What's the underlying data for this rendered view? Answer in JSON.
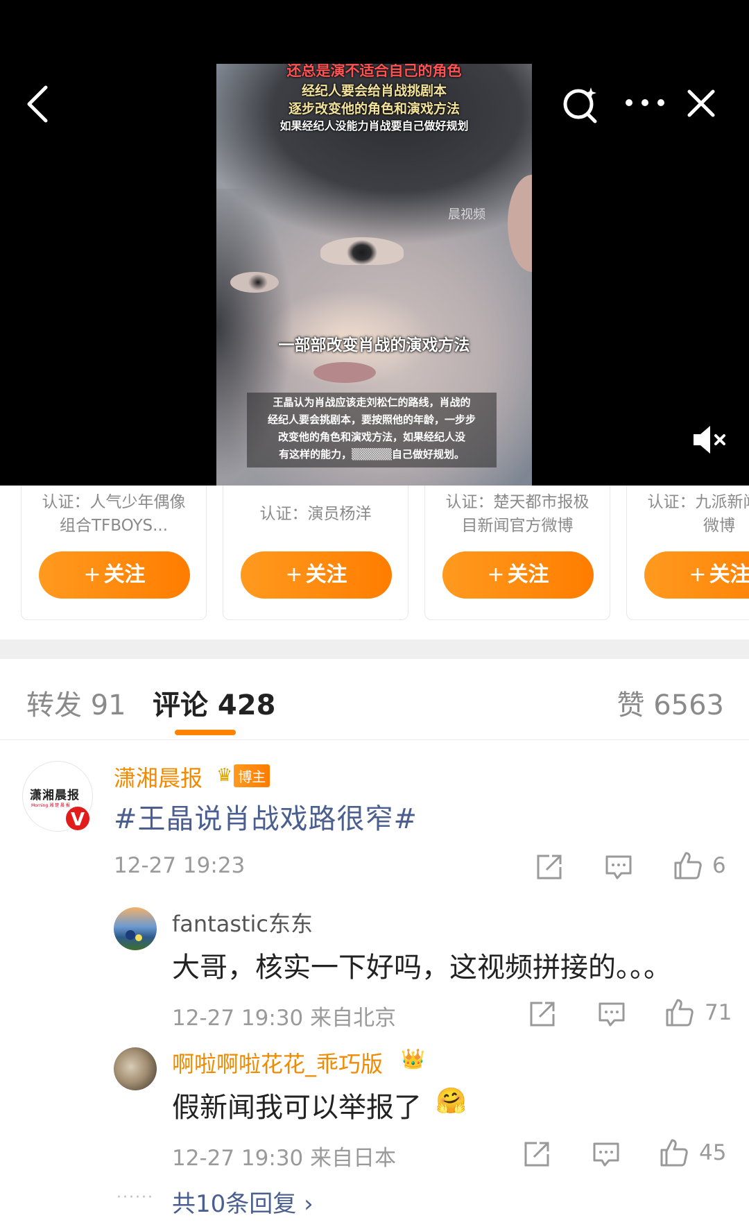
{
  "video": {
    "captions_top": [
      "还总是演不适合自己的角色",
      "经纪人要会给肖战挑剧本",
      "逐步改变他的角色和演戏方法",
      "如果经纪人没能力肖战要自己做好规划"
    ],
    "watermark": "晨视频",
    "caption_middle": "一部部改变肖战的演戏方法",
    "subtitle_lines": [
      "王晶认为肖战应该走刘松仁的路线，肖战的",
      "经纪人要会挑剧本，要按照他的年龄，一步步",
      "改变他的角色和演戏方法，如果经纪人没",
      "有这样的能力，▒▒▒▒▒自己做好规划。"
    ]
  },
  "recommendations": [
    {
      "cert": "认证：人气少年偶像组合TFBOYS...",
      "follow_label": "关注"
    },
    {
      "cert": "认证：演员杨洋",
      "follow_label": "关注"
    },
    {
      "cert": "认证：楚天都市报极目新闻官方微博",
      "follow_label": "关注"
    },
    {
      "cert": "认证：九派新闻官方微博",
      "follow_label": "关注"
    }
  ],
  "tabs": {
    "reposts": "转发 91",
    "comments": "评论 428",
    "likes": "赞 6563"
  },
  "comment": {
    "avatar_logo": "潇湘晨报",
    "avatar_sub": "Morning 湘 楚 晨 报",
    "author": "潇湘晨报",
    "badge": "博主",
    "text": "#王晶说肖战戏路很窄#",
    "time": "12-27 19:23",
    "likes": "6"
  },
  "replies": [
    {
      "author": "fantastic东东",
      "text": "大哥，核实一下好吗，这视频拼接的。。。",
      "time": "12-27 19:30 来自北京",
      "likes": "71"
    },
    {
      "author": "啊啦啊啦花花_乖巧版",
      "text": "假新闻我可以举报了",
      "time": "12-27 19:30 来自日本",
      "likes": "45"
    }
  ],
  "more_replies": "共10条回复 ›",
  "colors": {
    "accent_orange": "#ff8200",
    "link_blue": "#4a5f8f",
    "verified_red": "#e21b1b"
  }
}
